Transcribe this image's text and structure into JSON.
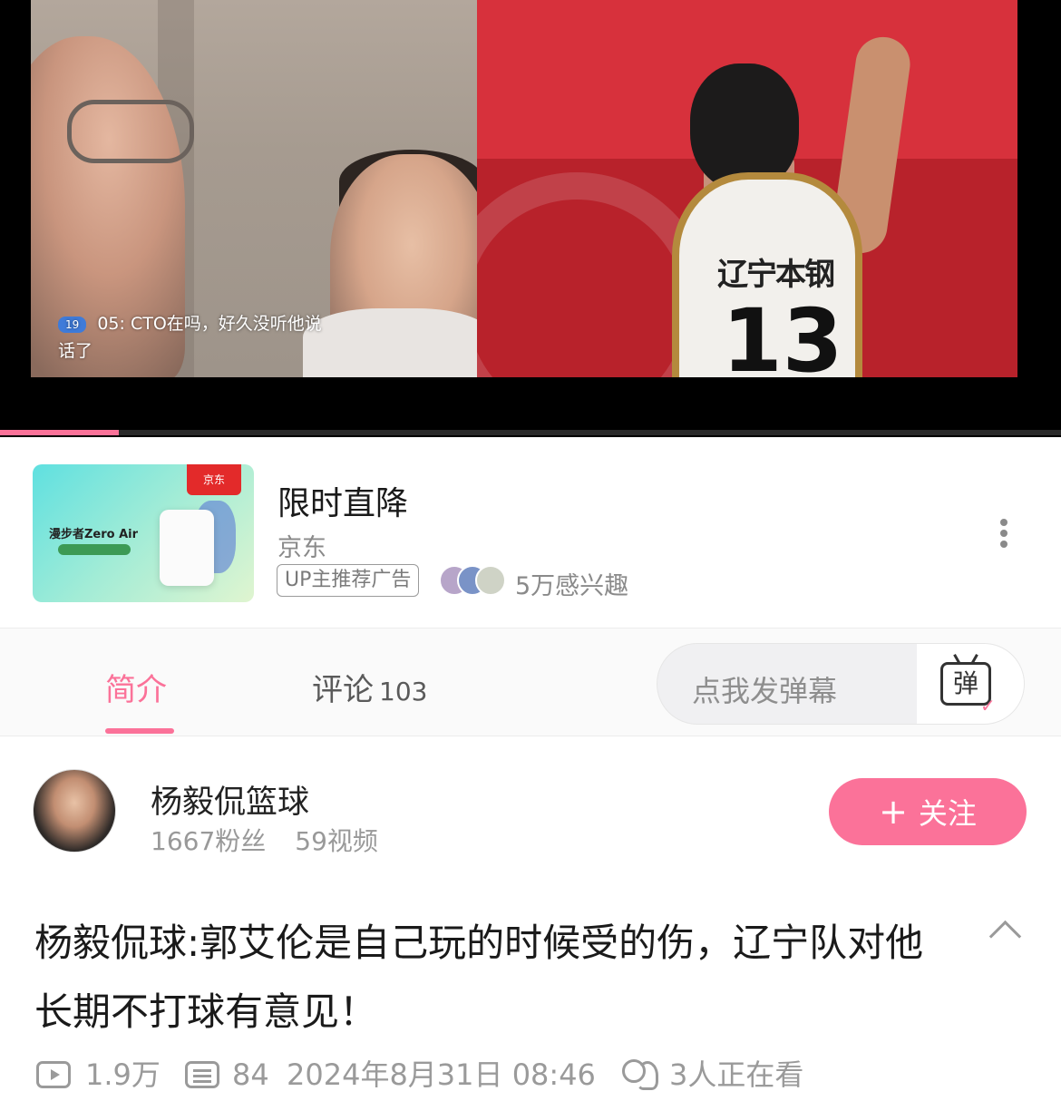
{
  "video": {
    "danmu_badge": "19",
    "danmu_user": "   05:",
    "danmu_line1": "CTO在吗，好久没听他说",
    "danmu_line2": "话了",
    "jersey_team": "辽宁本钢",
    "jersey_number": "13",
    "progress_percent": 11.2,
    "accent_color": "#fb7299"
  },
  "ad": {
    "thumb_tag": "京东",
    "thumb_product": "漫步者Zero Air",
    "title": "限时直降",
    "source": "京东",
    "badge": "UP主推荐广告",
    "interest": "5万感兴趣",
    "more_icon": "more-vertical-icon"
  },
  "tabs": {
    "intro_label": "简介",
    "comments_label": "评论",
    "comments_count": "103",
    "danmu_placeholder": "点我发弹幕",
    "danmu_button_glyph": "弹"
  },
  "author": {
    "name": "杨毅侃篮球",
    "fans": "1667粉丝",
    "videos": "59视频",
    "follow_plus": "+",
    "follow_label": "关注"
  },
  "title": {
    "text": "杨毅侃球:郭艾伦是自己玩的时候受的伤，辽宁队对他长期不打球有意见！"
  },
  "meta": {
    "plays": "1.9万",
    "danmu_count": "84",
    "datetime": "2024年8月31日 08:46",
    "watching": "3人正在看"
  }
}
